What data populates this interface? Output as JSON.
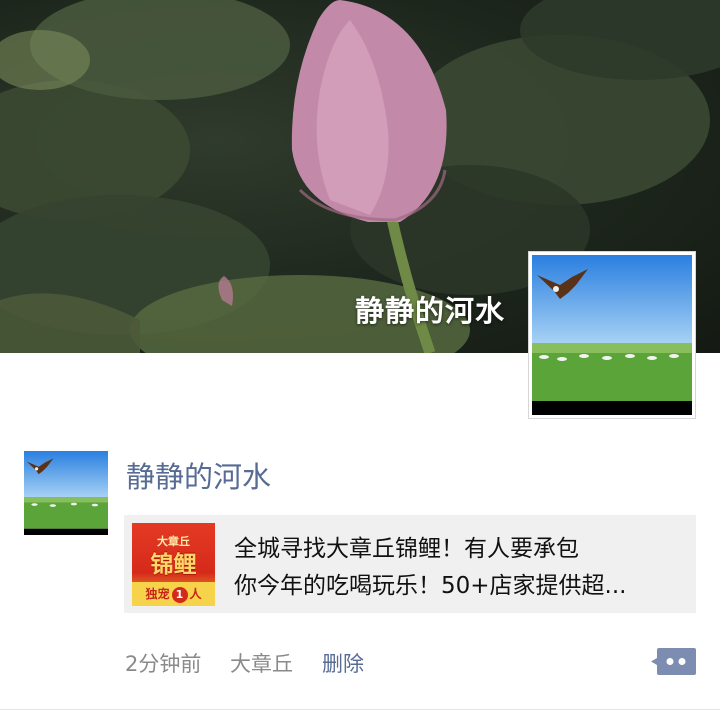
{
  "cover": {
    "title": "静静的河水"
  },
  "post": {
    "author": "静静的河水",
    "shared_link": {
      "thumbnail": {
        "brand": "大章丘",
        "title": "锦鲤",
        "footer_left": "独宠",
        "footer_number": "1",
        "footer_right": "人"
      },
      "line1": "全城寻找大章丘锦鲤！有人要承包",
      "line2": "你今年的吃喝玩乐！50+店家提供超..."
    },
    "time": "2分钟前",
    "location": "大章丘",
    "delete_label": "删除",
    "more_icon": "comment-more-icon"
  },
  "colors": {
    "link_blue": "#576b95",
    "meta_gray": "#8a8a8a",
    "card_bg": "#f0f0f0"
  }
}
